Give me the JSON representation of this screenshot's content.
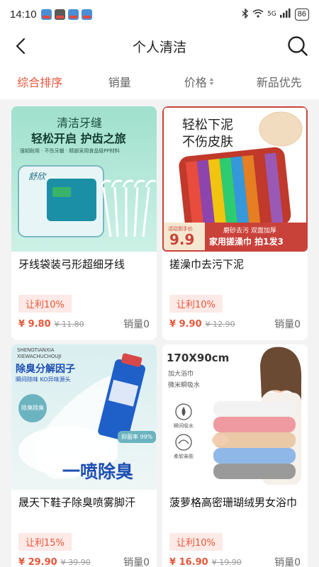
{
  "status_bar": {
    "time": "14:10",
    "network": "5G",
    "battery": "86"
  },
  "header": {
    "title": "个人清洁",
    "back_icon": "chevron-left-icon",
    "search_icon": "search-icon"
  },
  "tabs": [
    {
      "label": "综合排序",
      "active": true
    },
    {
      "label": "销量",
      "active": false
    },
    {
      "label": "价格",
      "active": false
    },
    {
      "label": "新品优先",
      "active": false
    }
  ],
  "products": [
    {
      "name": "牙线袋装弓形超细牙线",
      "tag": "让利10%",
      "price": "¥ 9.80",
      "original_price": "¥ 11.80",
      "sales": "销量0",
      "image_text": {
        "headline": "清洁牙缝",
        "sub": "轻松开启 护齿之旅",
        "note": "强韧耐用 · 不伤牙龈 · 精部采用食品级PP材料",
        "brand": "舒欣"
      }
    },
    {
      "name": "搓澡巾去污下泥",
      "tag": "让利10%",
      "price": "¥ 9.90",
      "original_price": "¥ 12.90",
      "sales": "销量0",
      "image_text": {
        "headline": "轻松下泥",
        "sub": "不伤皮肤",
        "promo_label": "活动到手价",
        "promo_price": "9.9",
        "promo_note": "磨砂去污 双面加厚",
        "promo_banner": "家用搓澡巾  拍1发3"
      }
    },
    {
      "name": "晟天下鞋子除臭喷雾脚汗",
      "tag": "让利15%",
      "price": "¥ 29.90",
      "original_price": "¥ 39.90",
      "sales": "销量0",
      "image_text": {
        "brand_line1": "SHENGTIANXIA",
        "brand_line2": "XIEWACHUCHOUJI",
        "headline": "除臭分解因子",
        "sub": "瞬间除味 KO异味源头",
        "badge1": "除臭除臭",
        "badge2": "抑菌率 99%",
        "slogan": "一喷除臭"
      }
    },
    {
      "name": "菠萝格高密珊瑚绒男女浴巾",
      "tag": "让利10%",
      "price": "¥ 16.90",
      "original_price": "¥ 19.90",
      "sales": "销量0",
      "image_text": {
        "size": "170X90cm",
        "line1": "加大浴巾",
        "line2": "微米瞬吸水",
        "feature1": "瞬间吸水",
        "feature2": "柔软亲肤"
      }
    }
  ],
  "colors": {
    "accent": "#e4573a",
    "tag_bg": "#fde9e6",
    "page_bg": "#f3f3f3"
  }
}
